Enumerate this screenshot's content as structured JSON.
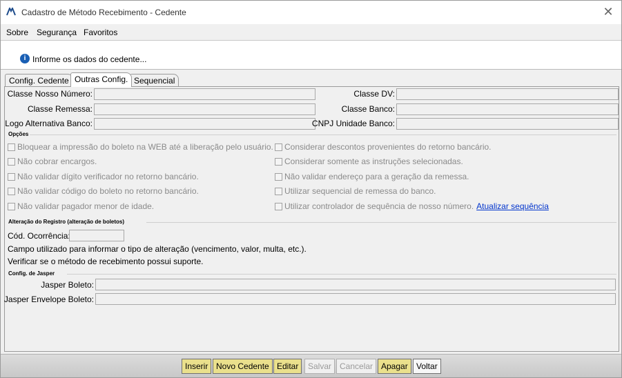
{
  "window": {
    "title": "Cadastro de Método Recebimento - Cedente",
    "close": "✕"
  },
  "menu": [
    "Sobre",
    "Segurança",
    "Favoritos"
  ],
  "info": "Informe os dados do cedente...",
  "tabs": [
    "Config. Cedente",
    "Outras Config.",
    "Sequencial"
  ],
  "fields": {
    "classe_nosso_numero": "Classe Nosso Número:",
    "classe_dv": "Classe DV:",
    "classe_remessa": "Classe Remessa:",
    "classe_banco": "Classe Banco:",
    "logo_alternativa": "Logo Alternativa Banco:",
    "cnpj_unidade": "CNPJ Unidade Banco:"
  },
  "opcoes": {
    "title": "Opções",
    "left": [
      "Bloquear a impressão do boleto na WEB até a liberação pelo usuário.",
      "Não cobrar encargos.",
      "Não validar dígito verificador no retorno bancário.",
      "Não validar código do boleto no retorno bancário.",
      "Não validar pagador menor de idade."
    ],
    "right": [
      "Considerar descontos provenientes do retorno bancário.",
      "Considerar somente as instruções selecionadas.",
      "Não validar endereço para a geração da remessa.",
      "Utilizar sequencial de remessa do banco.",
      "Utilizar controlador de sequência de nosso número."
    ],
    "link": "Atualizar sequência"
  },
  "alteracao": {
    "title": "Alteração do Registro (alteração de boletos)",
    "cod_label": "Cód. Ocorrência:",
    "desc1": "Campo utilizado para informar o tipo de alteração (vencimento, valor, multa, etc.).",
    "desc2": "Verificar se o método de recebimento possui suporte."
  },
  "jasper": {
    "title": "Config. de Jasper",
    "boleto": "Jasper Boleto:",
    "envelope": "Jasper Envelope Boleto:"
  },
  "buttons": [
    "Inserir",
    "Novo Cedente",
    "Editar",
    "Salvar",
    "Cancelar",
    "Apagar",
    "Voltar"
  ]
}
